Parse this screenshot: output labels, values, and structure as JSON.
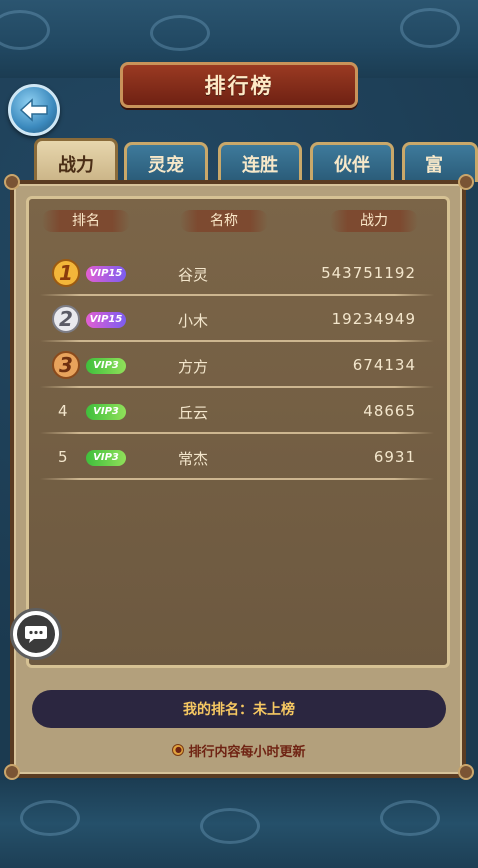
{
  "title": "排行榜",
  "tabs": [
    {
      "label": "战力",
      "active": true
    },
    {
      "label": "灵宠",
      "active": false
    },
    {
      "label": "连胜",
      "active": false
    },
    {
      "label": "伙伴",
      "active": false
    },
    {
      "label": "富",
      "active": false
    }
  ],
  "table_headers": {
    "rank": "排名",
    "name": "名称",
    "power": "战力"
  },
  "rows": [
    {
      "rank": "1",
      "vip": "VIP15",
      "name": "谷灵",
      "power": "543751192"
    },
    {
      "rank": "2",
      "vip": "VIP15",
      "name": "小木",
      "power": "19234949"
    },
    {
      "rank": "3",
      "vip": "VIP3",
      "name": "方方",
      "power": "674134"
    },
    {
      "rank": "4",
      "vip": "VIP3",
      "name": "丘云",
      "power": "48665"
    },
    {
      "rank": "5",
      "vip": "VIP3",
      "name": "常杰",
      "power": "6931"
    }
  ],
  "my_rank": "我的排名：未上榜",
  "note": "排行内容每小时更新",
  "colors": {
    "background": "#1d3a4f",
    "panel": "#b3a07c",
    "inner_panel": "#7b6548",
    "title_banner": "#9a3a22",
    "my_rank_bar": "#2b2640",
    "my_rank_text": "#f6c862"
  },
  "icons": {
    "back": "back-arrow-icon",
    "chat": "chat-bubble-icon",
    "medal_1": "gold-medal-icon",
    "medal_2": "silver-medal-icon",
    "medal_3": "bronze-medal-icon"
  }
}
